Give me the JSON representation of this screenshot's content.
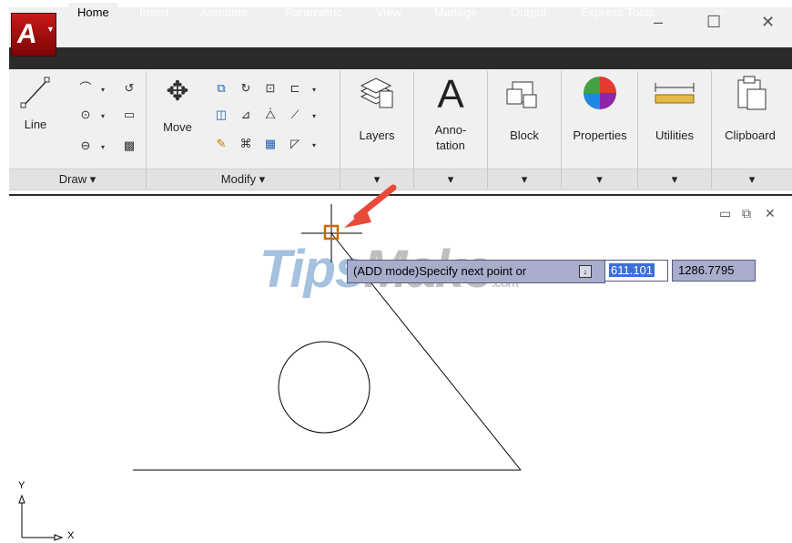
{
  "app": {
    "logo_letter": "A",
    "window_controls": {
      "minimize": "–",
      "maximize": "☐",
      "close": "✕"
    }
  },
  "tabs": [
    "Home",
    "Insert",
    "Annotate",
    "Parametric",
    "View",
    "Manage",
    "Output",
    "Express Tools"
  ],
  "ribbon": {
    "draw": {
      "line_label": "Line",
      "panel_label": "Draw ▾"
    },
    "modify": {
      "move_label": "Move",
      "panel_label": "Modify ▾"
    },
    "large_buttons": [
      {
        "label": "Layers",
        "icon": "layers-icon"
      },
      {
        "label": "Anno-\ntation",
        "icon": "annotation-icon",
        "glyph": "A"
      },
      {
        "label": "Block",
        "icon": "block-icon"
      },
      {
        "label": "Properties",
        "icon": "properties-icon"
      },
      {
        "label": "Utilities",
        "icon": "utilities-icon"
      },
      {
        "label": "Clipboard",
        "icon": "clipboard-icon"
      }
    ],
    "dropdown_glyph": "▾"
  },
  "drawing": {
    "viewport_controls": {
      "minimize": "▭",
      "restore": "⧉",
      "close": "✕"
    },
    "watermark_tips": "Tips",
    "watermark_make": "Make",
    "watermark_com": ".com",
    "command_prompt": "(ADD mode)Specify next point or",
    "input_x": "611.101",
    "input_y": "1286.7795",
    "ucs_y_label": "Y",
    "ucs_x_label": "X"
  },
  "colors": {
    "accent_arrow": "#e84a3a",
    "tab_strip": "#2b2b2b",
    "ribbon_bg": "#f0f0f0",
    "command_bg": "#a8adcc",
    "input_highlight": "#3a6fd8",
    "snap_marker": "#c96a00"
  }
}
